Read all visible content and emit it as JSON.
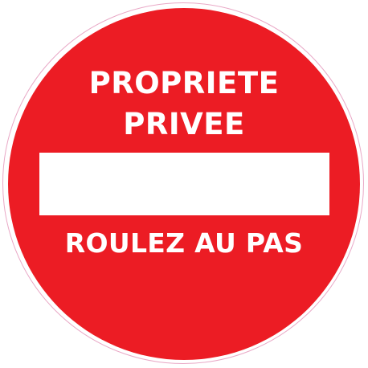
{
  "sign": {
    "line1": "PROPRIETE",
    "line2": "PRIVEE",
    "line3": "ROULEZ AU PAS"
  },
  "colors": {
    "disc": "#ec1c24",
    "text": "#ffffff",
    "bar": "#ffffff",
    "rim": "#e9a8c6"
  }
}
